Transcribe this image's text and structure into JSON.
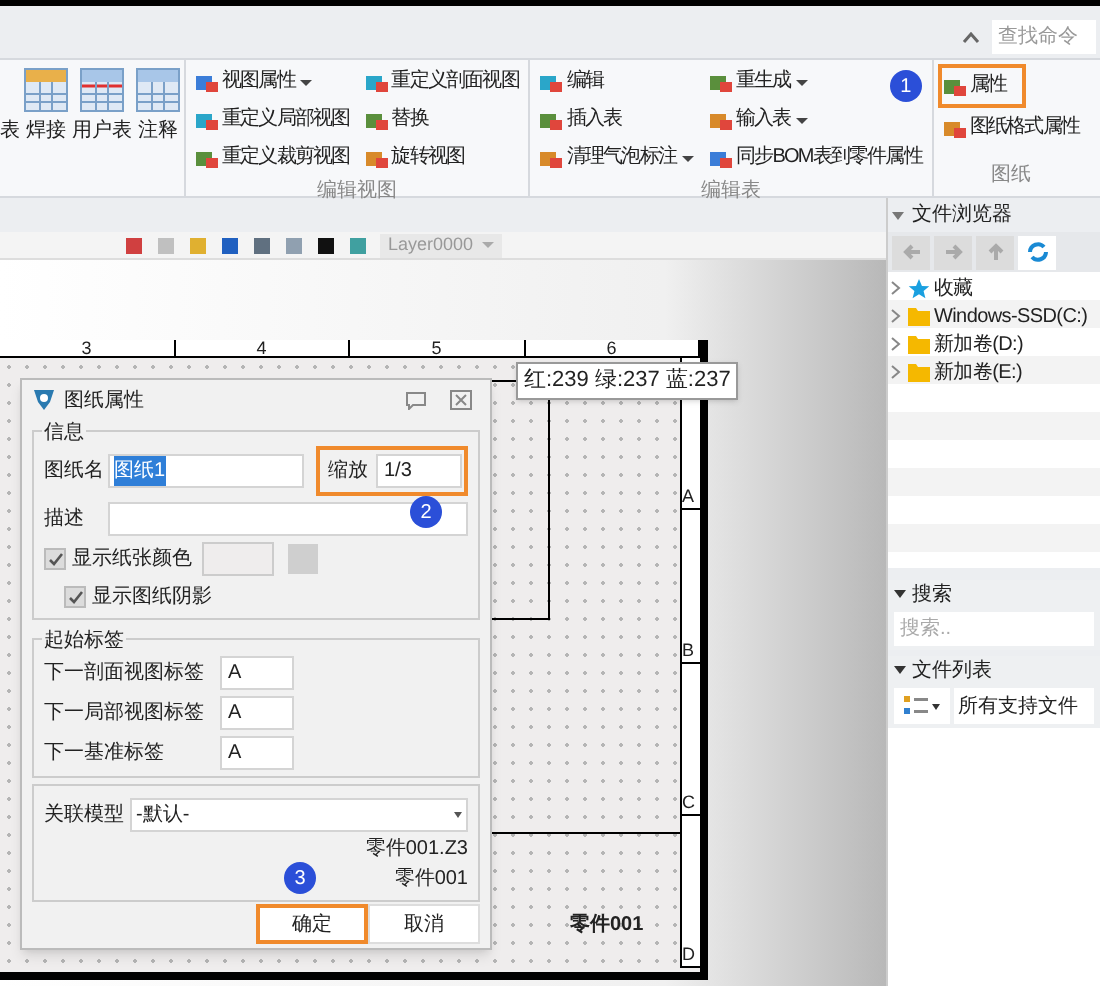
{
  "search_field": {
    "placeholder": "查找命令"
  },
  "ribbon": {
    "large_buttons": [
      {
        "label": "表"
      },
      {
        "label": "焊接"
      },
      {
        "label": "用户表"
      },
      {
        "label": "注释"
      }
    ],
    "groups": [
      {
        "title": "编辑视图",
        "columns": [
          [
            {
              "label": "视图属性",
              "dropdown": true,
              "highlighted": false
            },
            {
              "label": "重定义局部视图",
              "dropdown": false,
              "highlighted": false
            },
            {
              "label": "重定义裁剪视图",
              "dropdown": false,
              "highlighted": false
            }
          ],
          [
            {
              "label": "重定义剖面视图",
              "dropdown": false,
              "highlighted": false
            },
            {
              "label": "替换",
              "dropdown": false,
              "highlighted": false
            },
            {
              "label": "旋转视图",
              "dropdown": false,
              "highlighted": false
            }
          ]
        ]
      },
      {
        "title": "编辑表",
        "columns": [
          [
            {
              "label": "编辑",
              "dropdown": false,
              "highlighted": false
            },
            {
              "label": "插入表",
              "dropdown": false,
              "highlighted": false
            },
            {
              "label": "清理气泡标注",
              "dropdown": true,
              "highlighted": false
            }
          ],
          [
            {
              "label": "重生成",
              "dropdown": true,
              "highlighted": false
            },
            {
              "label": "输入表",
              "dropdown": true,
              "highlighted": false
            },
            {
              "label": "同步BOM表到零件属性",
              "dropdown": false,
              "highlighted": false
            }
          ]
        ]
      },
      {
        "title": "图纸",
        "badge": "1",
        "columns": [
          [
            {
              "label": "属性",
              "dropdown": false,
              "highlighted": true
            },
            {
              "label": "图纸格式属性",
              "dropdown": false,
              "highlighted": false
            }
          ]
        ]
      }
    ]
  },
  "toolbar": {
    "layer": "Layer0000"
  },
  "canvas": {
    "column_numbers": [
      "3",
      "4",
      "5",
      "6"
    ],
    "row_letters": [
      "A",
      "B",
      "C",
      "D"
    ],
    "title_block_text": "零件001",
    "tooltip": "红:239 绿:237 蓝:237"
  },
  "dialog": {
    "title": "图纸属性",
    "info": {
      "legend": "信息",
      "name_label": "图纸名",
      "name_value": "图纸1",
      "name_selected": true,
      "scale_label": "缩放",
      "scale_value": "1/3",
      "scale_highlighted": true,
      "badge": "2",
      "description_label": "描述",
      "checkboxes": [
        {
          "label": "显示纸张颜色",
          "checked": true
        },
        {
          "label": "显示图纸阴影",
          "checked": true
        }
      ]
    },
    "start_labels": {
      "legend": "起始标签",
      "rows": [
        {
          "label": "下一剖面视图标签",
          "value": "A"
        },
        {
          "label": "下一局部视图标签",
          "value": "A"
        },
        {
          "label": "下一基准标签",
          "value": "A"
        }
      ]
    },
    "model": {
      "label": "关联模型",
      "value": "-默认-",
      "lines": [
        "零件001.Z3",
        "零件001"
      ],
      "badge": "3"
    },
    "buttons": [
      {
        "label": "确定",
        "highlighted": true
      },
      {
        "label": "取消",
        "highlighted": false
      }
    ]
  },
  "file_browser": {
    "title": "文件浏览器",
    "tree": [
      {
        "label": "收藏",
        "kind": "favorites"
      },
      {
        "label": "Windows-SSD(C:)",
        "kind": "folder"
      },
      {
        "label": "新加卷(D:)",
        "kind": "folder"
      },
      {
        "label": "新加卷(E:)",
        "kind": "folder"
      }
    ],
    "search": {
      "title": "搜索",
      "placeholder": "搜索.."
    },
    "file_list": {
      "title": "文件列表",
      "filter": "所有支持文件"
    }
  }
}
